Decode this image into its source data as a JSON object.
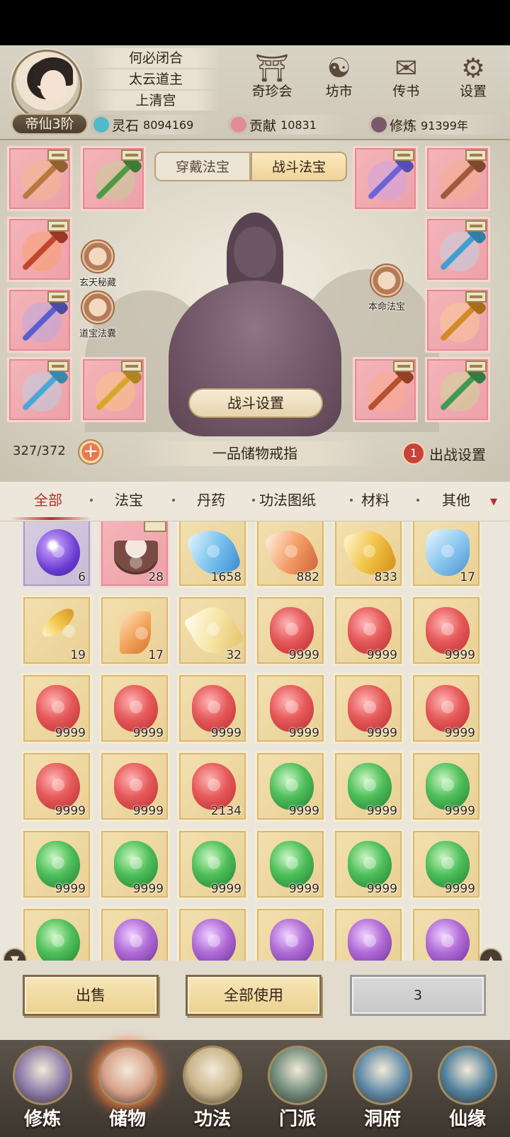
{
  "player": {
    "rank": "帝仙3阶",
    "name_lines": [
      "何必闭合",
      "太云道主",
      "上清宫"
    ]
  },
  "top_nav": [
    {
      "label": "奇珍会",
      "icon": "pavilion-icon"
    },
    {
      "label": "坊市",
      "icon": "market-icon"
    },
    {
      "label": "传书",
      "icon": "scroll-icon"
    },
    {
      "label": "设置",
      "icon": "gear-icon"
    }
  ],
  "resources": {
    "spirit_stone": {
      "name": "灵石",
      "value": "8094169",
      "color": "#4fb8c9"
    },
    "contribution": {
      "name": "贡献",
      "value": "10831",
      "color": "#e38b9a"
    },
    "cultivation": {
      "name": "修炼",
      "value": "91399年",
      "color": "#7a5a6a"
    }
  },
  "equip": {
    "tab_worn": "穿戴法宝",
    "tab_battle": "战斗法宝",
    "side_left": [
      {
        "label": "玄天秘藏",
        "icon": "swirl-treasure-icon"
      },
      {
        "label": "道宝法囊",
        "icon": "treasure-bag-icon"
      }
    ],
    "side_right": {
      "label": "本命法宝",
      "icon": "natal-sword-icon"
    },
    "battle_settings": "战斗设置"
  },
  "storage": {
    "capacity": "327/372",
    "ring_name": "一品储物戒指",
    "deploy_count": "1",
    "deploy_label": "出战设置"
  },
  "categories": [
    "全部",
    "法宝",
    "丹药",
    "功法图纸",
    "材料",
    "其他"
  ],
  "inventory": [
    {
      "kind": "orb",
      "count": "6",
      "frame": "purple"
    },
    {
      "kind": "bowl",
      "count": "28",
      "frame": "pink",
      "tag": true
    },
    {
      "kind": "blueshard",
      "count": "1658",
      "frame": "gold"
    },
    {
      "kind": "fireshard",
      "count": "882",
      "frame": "gold"
    },
    {
      "kind": "goldshard",
      "count": "833",
      "frame": "gold"
    },
    {
      "kind": "icegem",
      "count": "17",
      "frame": "gold"
    },
    {
      "kind": "feather",
      "count": "19",
      "frame": "gold"
    },
    {
      "kind": "serpent",
      "count": "17",
      "frame": "gold"
    },
    {
      "kind": "crystal",
      "count": "32",
      "frame": "gold"
    },
    {
      "kind": "red",
      "count": "9999",
      "frame": "gold"
    },
    {
      "kind": "red",
      "count": "9999",
      "frame": "gold"
    },
    {
      "kind": "red",
      "count": "9999",
      "frame": "gold"
    },
    {
      "kind": "red",
      "count": "9999",
      "frame": "gold"
    },
    {
      "kind": "red",
      "count": "9999",
      "frame": "gold"
    },
    {
      "kind": "red",
      "count": "9999",
      "frame": "gold"
    },
    {
      "kind": "red",
      "count": "9999",
      "frame": "gold"
    },
    {
      "kind": "red",
      "count": "9999",
      "frame": "gold"
    },
    {
      "kind": "red",
      "count": "9999",
      "frame": "gold"
    },
    {
      "kind": "red",
      "count": "9999",
      "frame": "gold"
    },
    {
      "kind": "red",
      "count": "9999",
      "frame": "gold"
    },
    {
      "kind": "red",
      "count": "2134",
      "frame": "gold"
    },
    {
      "kind": "green",
      "count": "9999",
      "frame": "gold"
    },
    {
      "kind": "green",
      "count": "9999",
      "frame": "gold"
    },
    {
      "kind": "green",
      "count": "9999",
      "frame": "gold"
    },
    {
      "kind": "green",
      "count": "9999",
      "frame": "gold"
    },
    {
      "kind": "green",
      "count": "9999",
      "frame": "gold"
    },
    {
      "kind": "green",
      "count": "9999",
      "frame": "gold"
    },
    {
      "kind": "green",
      "count": "9999",
      "frame": "gold"
    },
    {
      "kind": "green",
      "count": "9999",
      "frame": "gold"
    },
    {
      "kind": "green",
      "count": "9999",
      "frame": "gold"
    },
    {
      "kind": "green",
      "count": "",
      "frame": "gold"
    },
    {
      "kind": "purple",
      "count": "",
      "frame": "gold"
    },
    {
      "kind": "purple",
      "count": "",
      "frame": "gold"
    },
    {
      "kind": "purple",
      "count": "",
      "frame": "gold"
    },
    {
      "kind": "purple",
      "count": "",
      "frame": "gold"
    },
    {
      "kind": "purple",
      "count": "",
      "frame": "gold"
    }
  ],
  "actions": {
    "sell": "出售",
    "use_all": "全部使用",
    "quantity": "3"
  },
  "bottom_nav": [
    {
      "label": "修炼",
      "icon": "meditation-icon",
      "color": "#8c7aa8"
    },
    {
      "label": "储物",
      "icon": "storage-bag-icon",
      "color": "#d8a08a",
      "active": true
    },
    {
      "label": "功法",
      "icon": "technique-scroll-icon",
      "color": "#c9b48a"
    },
    {
      "label": "门派",
      "icon": "sect-gate-icon",
      "color": "#6f8a7a"
    },
    {
      "label": "洞府",
      "icon": "cave-mansion-icon",
      "color": "#5f8aa8"
    },
    {
      "label": "仙缘",
      "icon": "immortal-fate-icon",
      "color": "#4f7f9a"
    }
  ],
  "colors": {
    "accent_red": "#b4302a",
    "slot_pink": "#eda0a8",
    "cell_gold": "#e9cf93"
  }
}
